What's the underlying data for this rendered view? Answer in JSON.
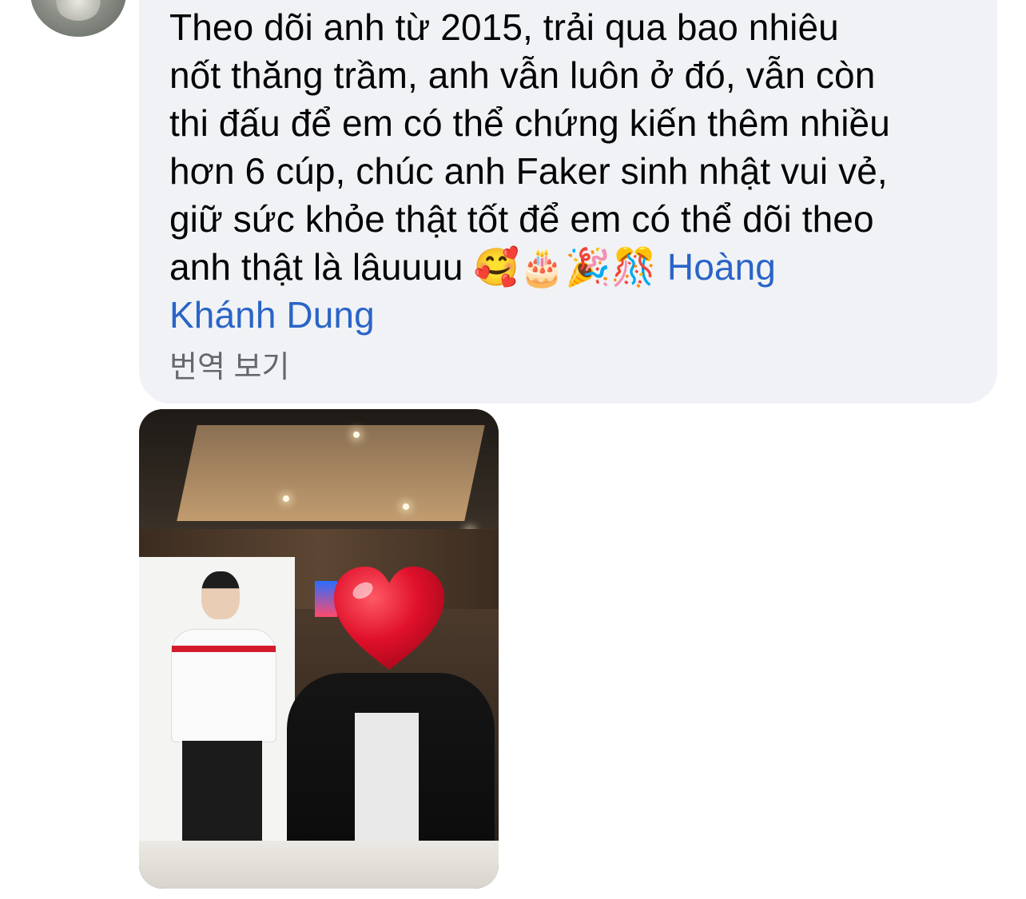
{
  "comment": {
    "text_lines": [
      "Theo dõi anh từ 2015, trải qua bao nhiêu",
      "nốt thăng trầm, anh vẫn luôn ở đó, vẫn còn",
      "thi đấu để em có thể chứng kiến thêm nhiều",
      "hơn 6 cúp, chúc anh Faker sinh nhật vui vẻ,",
      "giữ sức khỏe thật tốt để em có thể dõi theo"
    ],
    "last_line_text": "anh thật là lâuuuu",
    "emojis": [
      "🥰",
      "🎂",
      "🎉",
      "🎊"
    ],
    "mention_part1": "Hoàng",
    "mention_part2": "Khánh Dung",
    "translate_label": "번역 보기"
  },
  "colors": {
    "bubble_bg": "#f0f2f5",
    "text": "#050505",
    "mention": "#2a64c7",
    "secondary_text": "#65676b",
    "heart": "#e0102a"
  },
  "icons": {
    "avatar": "avatar-photo",
    "heart_sticker": "red-heart-icon"
  }
}
